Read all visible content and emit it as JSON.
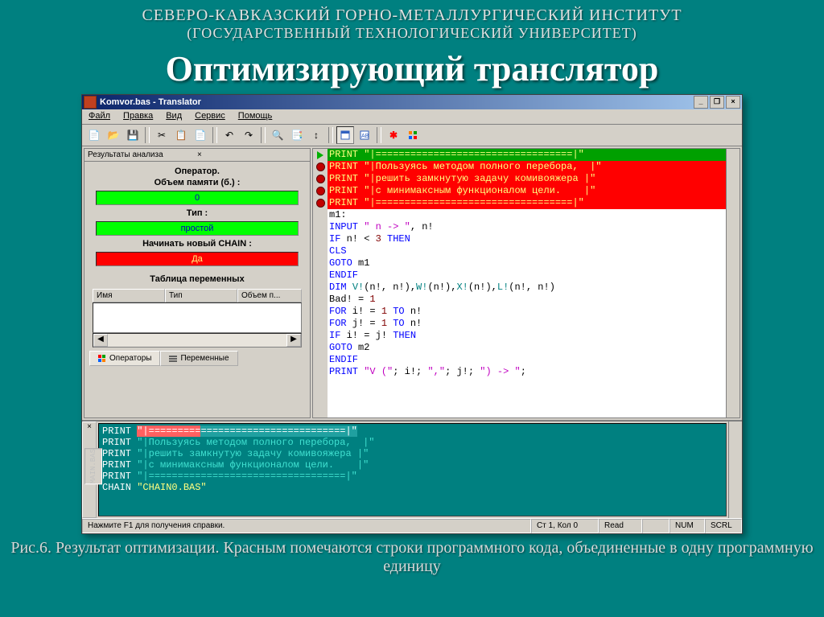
{
  "slide": {
    "header1": "СЕВЕРО-КАВКАЗСКИЙ ГОРНО-МЕТАЛЛУРГИЧЕСКИЙ ИНСТИТУТ",
    "header2": "(ГОСУДАРСТВЕННЫЙ ТЕХНОЛОГИЧЕСКИЙ УНИВЕРСИТЕТ)",
    "title": "Оптимизирующий транслятор",
    "caption": "Рис.6. Результат оптимизации. Красным помечаются строки программного кода, объединенные в одну программную единицу"
  },
  "window": {
    "title": "Komvor.bas - Translator"
  },
  "menu": {
    "file": "Файл",
    "edit": "Правка",
    "view": "Вид",
    "service": "Сервис",
    "help": "Помощь"
  },
  "panel": {
    "title": "Результаты анализа",
    "op_title": "Оператор.",
    "mem_label": "Объем памяти (б.) :",
    "mem_value": "0",
    "type_label": "Тип :",
    "type_value": "простой",
    "chain_label": "Начинать новый CHAIN :",
    "chain_value": "Да",
    "vars_title": "Таблица переменных",
    "col_name": "Имя",
    "col_type": "Тип",
    "col_mem": "Объем п...",
    "tab_ops": "Операторы",
    "tab_vars": "Переменные"
  },
  "code": [
    {
      "g": "arrow",
      "bg": "green",
      "html": "<span style='color:#ffff80'>PRINT </span><span style='color:#ffff80'>\"|==================================|\"</span>"
    },
    {
      "g": "dot",
      "bg": "red",
      "html": "<span style='color:#ffff80'>PRINT </span><span style='color:#ffff80'>\"|Пользуясь методом полного перебора,  |\"</span>"
    },
    {
      "g": "dot",
      "bg": "red",
      "html": "<span style='color:#ffff80'>PRINT </span><span style='color:#ffff80'>\"|решить замкнутую задачу комивояжера |\"</span>"
    },
    {
      "g": "dot",
      "bg": "red",
      "html": "<span style='color:#ffff80'>PRINT </span><span style='color:#ffff80'>\"|с минимаксным функционалом цели.    |\"</span>"
    },
    {
      "g": "dot",
      "bg": "red",
      "html": "<span style='color:#ffff80'>PRINT </span><span style='color:#ffff80'>\"|==================================|\"</span>"
    },
    {
      "g": "",
      "bg": "",
      "html": "m1:"
    },
    {
      "g": "",
      "bg": "",
      "html": "<span class='kw'>INPUT</span> <span class='mag'>\" n -> \"</span>, n!"
    },
    {
      "g": "",
      "bg": "",
      "html": "<span class='kw'>IF</span> n! <span class='str'>&lt;</span> <span class='num'>3</span> <span class='kw'>THEN</span>"
    },
    {
      "g": "",
      "bg": "",
      "html": "<span class='kw'>CLS</span>"
    },
    {
      "g": "",
      "bg": "",
      "html": "<span class='kw'>GOTO</span> m1"
    },
    {
      "g": "",
      "bg": "",
      "html": "<span class='kw'>ENDIF</span>"
    },
    {
      "g": "",
      "bg": "",
      "html": "<span class='kw'>DIM</span> <span class='cy'>V!</span>(n!, n!),<span class='cy'>W!</span>(n!),<span class='cy'>X!</span>(n!),<span class='cy'>L!</span>(n!, n!)"
    },
    {
      "g": "",
      "bg": "",
      "html": "Bad! = <span class='num'>1</span>"
    },
    {
      "g": "",
      "bg": "",
      "html": "<span class='kw'>FOR</span> i! = <span class='num'>1</span> <span class='kw'>TO</span> n!"
    },
    {
      "g": "",
      "bg": "",
      "html": "<span class='kw'>FOR</span> j! = <span class='num'>1</span> <span class='kw'>TO</span> n!"
    },
    {
      "g": "",
      "bg": "",
      "html": "<span class='kw'>IF</span> i! = j! <span class='kw'>THEN</span>"
    },
    {
      "g": "",
      "bg": "",
      "html": "<span class='kw'>GOTO</span> m2"
    },
    {
      "g": "",
      "bg": "",
      "html": "<span class='kw'>ENDIF</span>"
    },
    {
      "g": "",
      "bg": "",
      "html": "<span class='kw'>PRINT</span> <span class='mag'>\"V (\"</span>; i!; <span class='mag'>\",\"</span>; j!; <span class='mag'>\") -> \"</span>;"
    }
  ],
  "bottom": [
    {
      "html": "<span class='bkw'>PRINT </span><span class='bhl-red'>\"|=========</span><span class='bhl-teal'>=========================|\"</span>"
    },
    {
      "html": "<span class='bkw'>PRINT </span><span class='bstr'>\"|Пользуясь методом полного перебора,  |\"</span>"
    },
    {
      "html": "<span class='bkw'>PRINT </span><span class='bstr'>\"|решить замкнутую задачу комивояжера |\"</span>"
    },
    {
      "html": "<span class='bkw'>PRINT </span><span class='bstr'>\"|с минимаксным функционалом цели.    |\"</span>"
    },
    {
      "html": "<span class='bkw'>PRINT </span><span class='bstr'>\"|==================================|\"</span>"
    },
    {
      "html": "<span class='bkw'>CHAIN </span><span class='byl'>\"CHAIN0.BAS\"</span>"
    }
  ],
  "bottom_tab": "MAIN.BAS",
  "status": {
    "hint": "Нажмите F1 для получения справки.",
    "pos": "Ст 1, Кол 0",
    "mode": "Read",
    "num": "NUM",
    "scrl": "SCRL"
  }
}
